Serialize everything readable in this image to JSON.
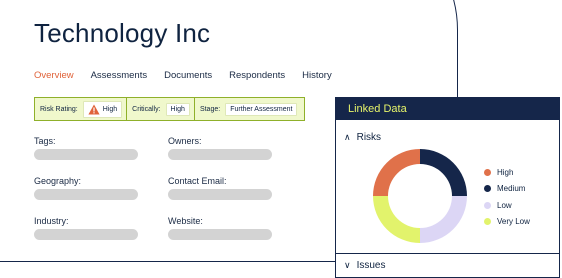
{
  "company": {
    "name": "Technology Inc"
  },
  "tabs": [
    {
      "label": "Overview",
      "active": true
    },
    {
      "label": "Assessments",
      "active": false
    },
    {
      "label": "Documents",
      "active": false
    },
    {
      "label": "Respondents",
      "active": false
    },
    {
      "label": "History",
      "active": false
    }
  ],
  "status": {
    "risk_rating_label": "Risk Rating:",
    "risk_rating_value": "High",
    "criticality_label": "Critically:",
    "criticality_value": "High",
    "stage_label": "Stage:",
    "stage_value": "Further Assessment"
  },
  "fields": {
    "tags": "Tags:",
    "owners": "Owners:",
    "geography": "Geography:",
    "contact_email": "Contact Email:",
    "industry": "Industry:",
    "website": "Website:"
  },
  "linked_data": {
    "title": "Linked Data",
    "risks_label": "Risks",
    "issues_label": "Issues"
  },
  "icons": {
    "risk_warning": "warning-triangle-icon",
    "risks_toggle": "chevron-up-icon",
    "issues_toggle": "chevron-down-icon"
  },
  "chart_data": {
    "type": "pie",
    "donut": true,
    "categories": [
      "High",
      "Medium",
      "Low",
      "Very Low"
    ],
    "values": [
      25,
      25,
      25,
      25
    ],
    "colors": [
      "#e0714a",
      "#15264a",
      "#dcd6f5",
      "#e2f36c"
    ],
    "legend": "right"
  },
  "colors": {
    "navy": "#15264a",
    "accent_orange": "#e0633a",
    "lime": "#e6f46a",
    "status_bg": "#f0f8cc"
  }
}
